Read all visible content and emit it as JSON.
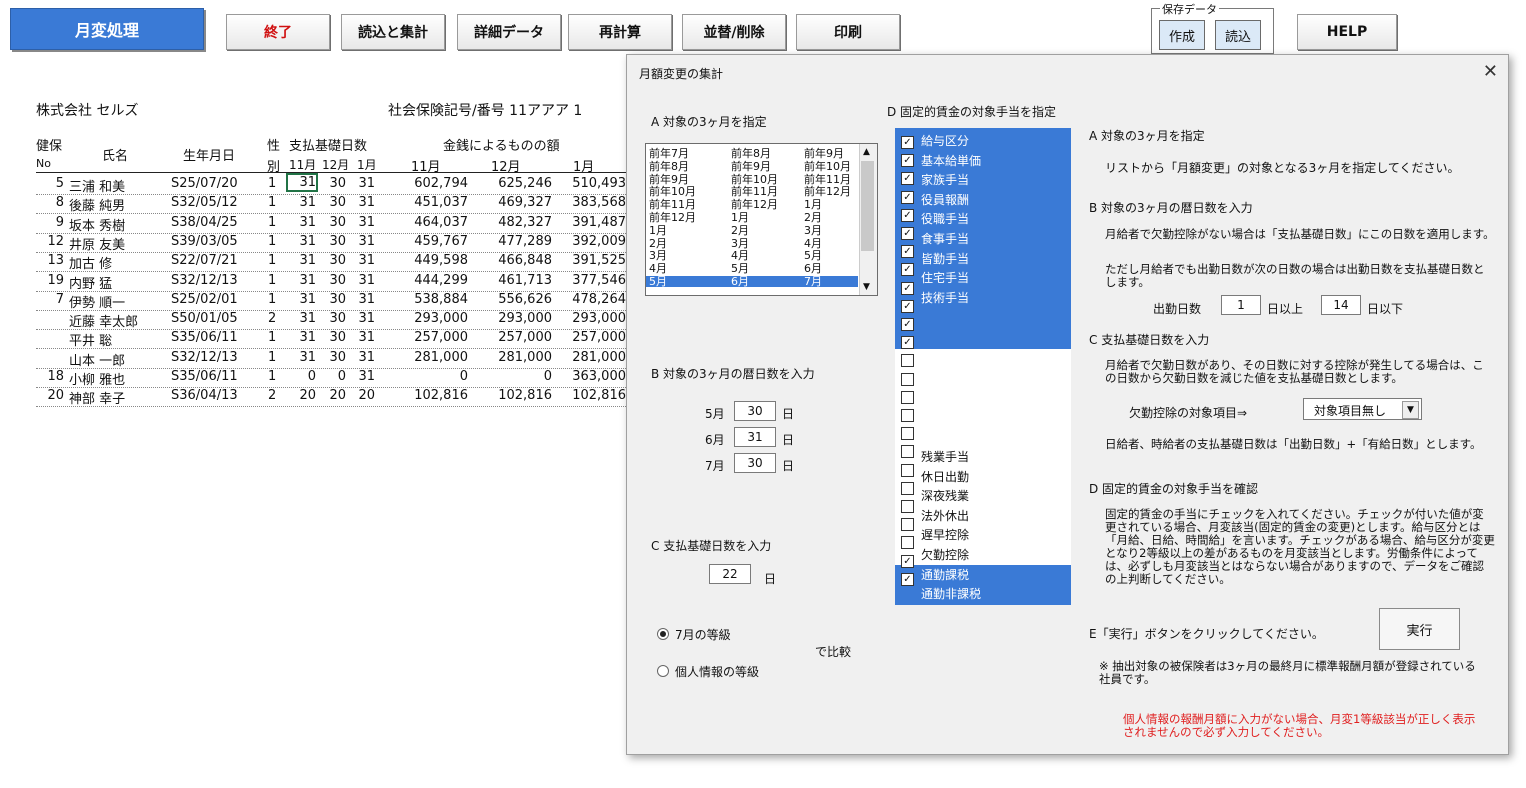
{
  "toolbar": {
    "monthly_change": "月変処理",
    "quit": "終了",
    "load_aggregate": "読込と集計",
    "detail_data": "詳細データ",
    "recalc": "再計算",
    "sort_delete": "並替/削除",
    "print": "印刷",
    "save_data_label": "保存データ",
    "create": "作成",
    "load": "読込",
    "help": "HELP"
  },
  "sheet": {
    "company": "株式会社 セルズ",
    "insurance_label": "社会保険記号/番号 11アアア 1",
    "headers": {
      "kenpo": "健保",
      "no": "No",
      "name": "氏名",
      "birth": "生年月日",
      "sex": "性",
      "sex2": "別",
      "basis_days": "支払基礎日数",
      "m11": "11月",
      "m12": "12月",
      "m1": "1月",
      "money": "金銭によるものの額",
      "a11": "11月",
      "a12": "12月",
      "a1": "1月"
    },
    "rows": [
      {
        "no": "5",
        "name": "三浦 和美",
        "birth": "S25/07/20",
        "sex": "1",
        "d11": "31",
        "d12": "30",
        "d1": "31",
        "a11": "602,794",
        "a12": "625,246",
        "a1": "510,493"
      },
      {
        "no": "8",
        "name": "後藤 純男",
        "birth": "S32/05/12",
        "sex": "1",
        "d11": "31",
        "d12": "30",
        "d1": "31",
        "a11": "451,037",
        "a12": "469,327",
        "a1": "383,568"
      },
      {
        "no": "9",
        "name": "坂本 秀樹",
        "birth": "S38/04/25",
        "sex": "1",
        "d11": "31",
        "d12": "30",
        "d1": "31",
        "a11": "464,037",
        "a12": "482,327",
        "a1": "391,487"
      },
      {
        "no": "12",
        "name": "井原 友美",
        "birth": "S39/03/05",
        "sex": "1",
        "d11": "31",
        "d12": "30",
        "d1": "31",
        "a11": "459,767",
        "a12": "477,289",
        "a1": "392,009"
      },
      {
        "no": "13",
        "name": "加古 修",
        "birth": "S22/07/21",
        "sex": "1",
        "d11": "31",
        "d12": "30",
        "d1": "31",
        "a11": "449,598",
        "a12": "466,848",
        "a1": "391,525"
      },
      {
        "no": "19",
        "name": "内野 猛",
        "birth": "S32/12/13",
        "sex": "1",
        "d11": "31",
        "d12": "30",
        "d1": "31",
        "a11": "444,299",
        "a12": "461,713",
        "a1": "377,546"
      },
      {
        "no": "7",
        "name": "伊勢 順一",
        "birth": "S25/02/01",
        "sex": "1",
        "d11": "31",
        "d12": "30",
        "d1": "31",
        "a11": "538,884",
        "a12": "556,626",
        "a1": "478,264"
      },
      {
        "no": "",
        "name": "近藤 幸太郎",
        "birth": "S50/01/05",
        "sex": "2",
        "d11": "31",
        "d12": "30",
        "d1": "31",
        "a11": "293,000",
        "a12": "293,000",
        "a1": "293,000"
      },
      {
        "no": "",
        "name": "平井 聡",
        "birth": "S35/06/11",
        "sex": "1",
        "d11": "31",
        "d12": "30",
        "d1": "31",
        "a11": "257,000",
        "a12": "257,000",
        "a1": "257,000"
      },
      {
        "no": "",
        "name": "山本 一郎",
        "birth": "S32/12/13",
        "sex": "1",
        "d11": "31",
        "d12": "30",
        "d1": "31",
        "a11": "281,000",
        "a12": "281,000",
        "a1": "281,000"
      },
      {
        "no": "18",
        "name": "小柳 雅也",
        "birth": "S35/06/11",
        "sex": "1",
        "d11": "0",
        "d12": "0",
        "d1": "31",
        "a11": "0",
        "a12": "0",
        "a1": "363,000"
      },
      {
        "no": "20",
        "name": "神部 幸子",
        "birth": "S36/04/13",
        "sex": "2",
        "d11": "20",
        "d12": "20",
        "d1": "20",
        "a11": "102,816",
        "a12": "102,816",
        "a1": "102,816"
      }
    ]
  },
  "dialog": {
    "title": "月額変更の集計",
    "close": "✕",
    "sec_a": "A 対象の3ヶ月を指定",
    "months_list": [
      [
        "前年7月",
        "前年8月",
        "前年9月"
      ],
      [
        "前年8月",
        "前年9月",
        "前年10月"
      ],
      [
        "前年9月",
        "前年10月",
        "前年11月"
      ],
      [
        "前年10月",
        "前年11月",
        "前年12月"
      ],
      [
        "前年11月",
        "前年12月",
        "1月"
      ],
      [
        "前年12月",
        "1月",
        "2月"
      ],
      [
        "1月",
        "2月",
        "3月"
      ],
      [
        "2月",
        "3月",
        "4月"
      ],
      [
        "3月",
        "4月",
        "5月"
      ],
      [
        "4月",
        "5月",
        "6月"
      ],
      [
        "5月",
        "6月",
        "7月"
      ]
    ],
    "sec_b": "B 対象の3ヶ月の暦日数を入力",
    "b_rows": [
      {
        "label": "5月",
        "value": "30",
        "unit": "日"
      },
      {
        "label": "6月",
        "value": "31",
        "unit": "日"
      },
      {
        "label": "7月",
        "value": "30",
        "unit": "日"
      }
    ],
    "sec_c": "C 支払基礎日数を入力",
    "c_value": "22",
    "c_unit": "日",
    "radio1": "7月の等級",
    "radio2": "個人情報の等級",
    "compare": "で比較",
    "sec_d": "D 固定的賃金の対象手当を指定",
    "allowances_top": [
      "給与区分",
      "基本給単価",
      "家族手当",
      "役員報酬",
      "役職手当",
      "食事手当",
      "皆勤手当",
      "住宅手当",
      "技術手当"
    ],
    "allowances_bottom": [
      "残業手当",
      "休日出勤",
      "深夜残業",
      "法外休出",
      "遅早控除",
      "欠勤控除",
      "通勤課税",
      "通勤非課税"
    ],
    "help": {
      "a_title": "A 対象の3ヶ月を指定",
      "a_text": "リストから「月額変更」の対象となる3ヶ月を指定してください。",
      "b_title": "B 対象の3ヶ月の暦日数を入力",
      "b_text1": "月給者で欠勤控除がない場合は「支払基礎日数」にこの日数を適用します。",
      "b_text2": "ただし月給者でも出勤日数が次の日数の場合は出勤日数を支払基礎日数とします。",
      "work_days": "出勤日数",
      "min_days": "1",
      "above": "日以上",
      "max_days": "14",
      "below": "日以下",
      "c_title": "C 支払基礎日数を入力",
      "c_text": "月給者で欠勤日数があり、その日数に対する控除が発生してる場合は、この日数から欠勤日数を減じた値を支払基礎日数とします。",
      "absence_item": "欠勤控除の対象項目⇒",
      "absence_value": "対象項目無し",
      "c_text2": "日給者、時給者の支払基礎日数は「出勤日数」+「有給日数」とします。",
      "d_title": "D 固定的賃金の対象手当を確認",
      "d_text": "固定的賃金の手当にチェックを入れてください。チェックが付いた値が変更されている場合、月変該当(固定的賃金の変更)とします。給与区分とは「月給、日給、時間給」を言います。チェックがある場合、給与区分が変更となり2等級以上の差があるものを月変該当とします。労働条件によっては、必ずしも月変該当とはならない場合がありますので、データをご確認の上判断してください。",
      "e_title": "E「実行」ボタンをクリックしてください。",
      "execute": "実行",
      "note": "※ 抽出対象の被保険者は3ヶ月の最終月に標準報酬月額が登録されている社員です。",
      "warning": "個人情報の報酬月額に入力がない場合、月変1等級該当が正しく表示されませんので必ず入力してください。"
    }
  }
}
